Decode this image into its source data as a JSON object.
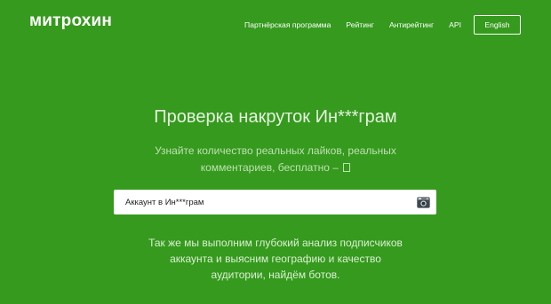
{
  "header": {
    "logo": "митрохин",
    "nav": [
      {
        "label": "Партнёрская программа"
      },
      {
        "label": "Рейтинг"
      },
      {
        "label": "Антирейтинг"
      },
      {
        "label": "API"
      }
    ],
    "language_button": "English"
  },
  "hero": {
    "title": "Проверка накруток Ин***грам",
    "subtitle_line1": "Узнайте количество реальных лайков, реальных",
    "subtitle_line2": "комментариев, бесплатно –"
  },
  "search": {
    "placeholder": "Аккаунт в Ин***грам",
    "icon": "camera-icon"
  },
  "description": {
    "line1": "Так же мы выполним глубокий анализ подписчиков",
    "line2": "аккаунта и выясним географию и качество",
    "line3": "аудитории, найдём ботов."
  },
  "colors": {
    "background": "#359a1d",
    "text": "#ffffff"
  }
}
